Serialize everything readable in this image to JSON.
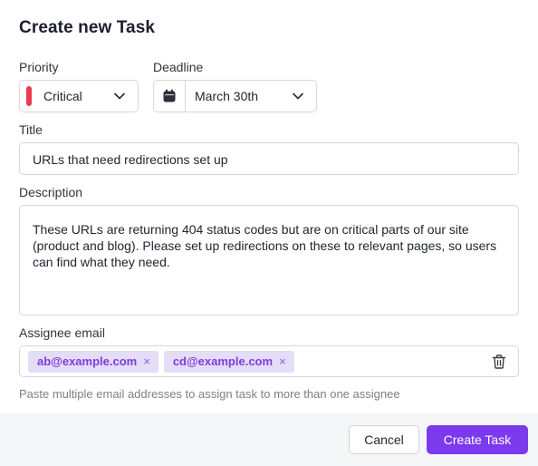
{
  "dialog": {
    "title": "Create new Task"
  },
  "priority": {
    "label": "Priority",
    "value": "Critical",
    "color": "#ef3b4f"
  },
  "deadline": {
    "label": "Deadline",
    "value": "March 30th"
  },
  "title_field": {
    "label": "Title",
    "value": "URLs that need redirections set up"
  },
  "description": {
    "label": "Description",
    "value": "These URLs are returning 404 status codes but are on critical parts of our site (product and blog). Please set up redirections on these to relevant pages, so users can find what they need."
  },
  "assignee": {
    "label": "Assignee email",
    "tags": [
      {
        "email": "ab@example.com",
        "remove": "×"
      },
      {
        "email": "cd@example.com",
        "remove": "×"
      }
    ],
    "hint": "Paste multiple email addresses to assign task to more than one assignee"
  },
  "footer": {
    "cancel_label": "Cancel",
    "create_label": "Create Task"
  },
  "colors": {
    "accent": "#7c3aed",
    "tag_bg": "#e5dcf8",
    "tag_text": "#7b3fd9"
  },
  "icons": [
    "chevron-down-icon",
    "calendar-icon",
    "close-icon",
    "trash-icon"
  ]
}
